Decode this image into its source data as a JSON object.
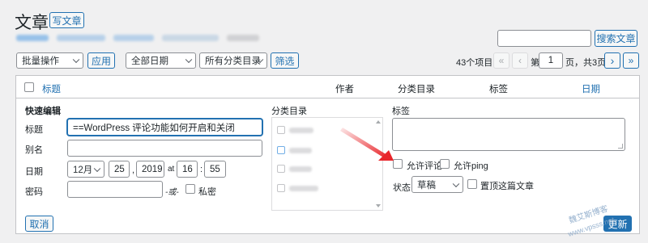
{
  "header": {
    "title": "文章",
    "add_new": "写文章"
  },
  "search": {
    "button": "搜索文章",
    "value": ""
  },
  "bulk": {
    "action_selected": "批量操作",
    "apply": "应用",
    "date_selected": "全部日期",
    "category_selected": "所有分类目录",
    "filter": "筛选"
  },
  "pagination": {
    "items_count": "43个项目",
    "first": "«",
    "prev": "‹",
    "page_prefix": "第",
    "current_page": "1",
    "page_suffix": "页，共3页",
    "next": "›",
    "last": "»"
  },
  "table": {
    "col_title": "标题",
    "col_author": "作者",
    "col_categories": "分类目录",
    "col_tags": "标签",
    "col_date": "日期"
  },
  "quick_edit": {
    "heading": "快速编辑",
    "title_label": "标题",
    "title_value": "==WordPress 评论功能如何开启和关闭",
    "slug_label": "别名",
    "slug_value": "",
    "date_label": "日期",
    "month": "12月",
    "day": "25",
    "year": "2019",
    "at": "at",
    "hour": "16",
    "colon": ":",
    "minute": "55",
    "comma": ",",
    "password_label": "密码",
    "or_label": "-或-",
    "private_label": "私密",
    "categories_label": "分类目录",
    "tags_label": "标签",
    "allow_comments": "允许评论",
    "allow_ping": "允许ping",
    "status_label": "状态",
    "status_value": "草稿",
    "sticky_label": "置顶这篇文章",
    "cancel": "取消",
    "update": "更新"
  },
  "colors": {
    "accent": "#2271b1",
    "arrow": "#e8262b",
    "watermark": "#8ba9c9"
  },
  "watermark": {
    "site_name": "魏艾斯博客",
    "url": "www.vpsss.net"
  }
}
